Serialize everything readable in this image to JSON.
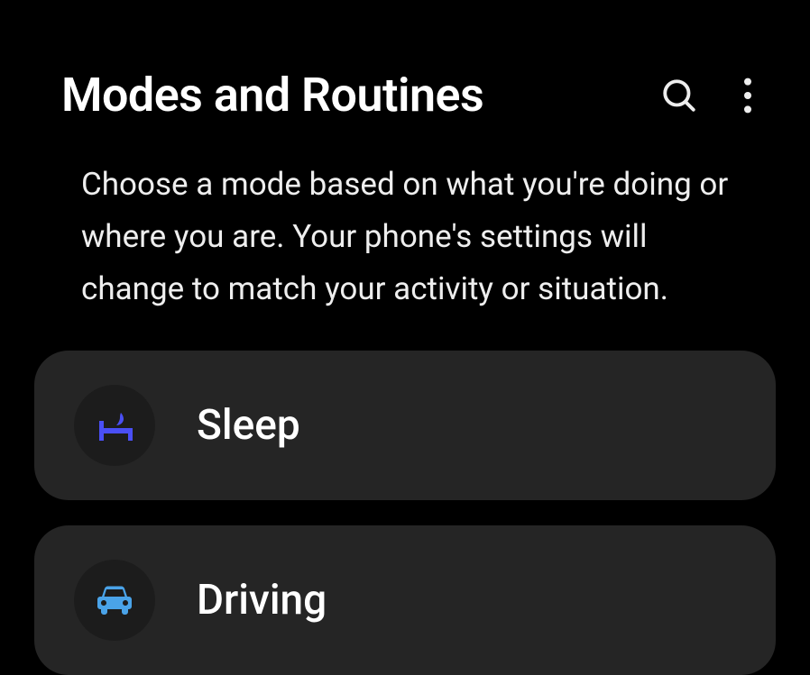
{
  "header": {
    "title": "Modes and Routines"
  },
  "description": "Choose a mode based on what you're doing or where you are. Your phone's settings will change to match your activity or situation.",
  "modes": [
    {
      "label": "Sleep",
      "icon": "sleep-icon",
      "color": "#4a4ff5"
    },
    {
      "label": "Driving",
      "icon": "car-icon",
      "color": "#4aa3e8"
    }
  ]
}
